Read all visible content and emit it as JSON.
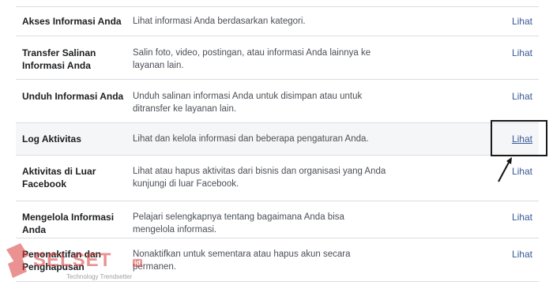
{
  "settings": {
    "rows": [
      {
        "title": "Akses Informasi Anda",
        "description": "Lihat informasi Anda berdasarkan kategori.",
        "action": "Lihat"
      },
      {
        "title": "Transfer Salinan Informasi Anda",
        "description": "Salin foto, video, postingan, atau informasi Anda lainnya ke layanan lain.",
        "action": "Lihat"
      },
      {
        "title": "Unduh Informasi Anda",
        "description": "Unduh salinan informasi Anda untuk disimpan atau untuk ditransfer ke layanan lain.",
        "action": "Lihat"
      },
      {
        "title": "Log Aktivitas",
        "description": "Lihat dan kelola informasi dan beberapa pengaturan Anda.",
        "action": "Lihat"
      },
      {
        "title": "Aktivitas di Luar Facebook",
        "description": "Lihat atau hapus aktivitas dari bisnis dan organisasi yang Anda kunjungi di luar Facebook.",
        "action": "Lihat"
      },
      {
        "title": "Mengelola Informasi Anda",
        "description": "Pelajari selengkapnya tentang bagaimana Anda bisa mengelola informasi.",
        "action": "Lihat"
      },
      {
        "title": "Penonaktifan dan Penghapusan",
        "description": "Nonaktifkan untuk sementara atau hapus akun secara permanen.",
        "action": "Lihat"
      }
    ]
  },
  "watermark": {
    "name": "SELSET",
    "badge": "id",
    "tagline": "Technology Trendsetter"
  },
  "colors": {
    "link": "#385898",
    "highlight_row": "#f5f6f7",
    "divider": "#dadde1",
    "watermark": "#d93a3a"
  }
}
